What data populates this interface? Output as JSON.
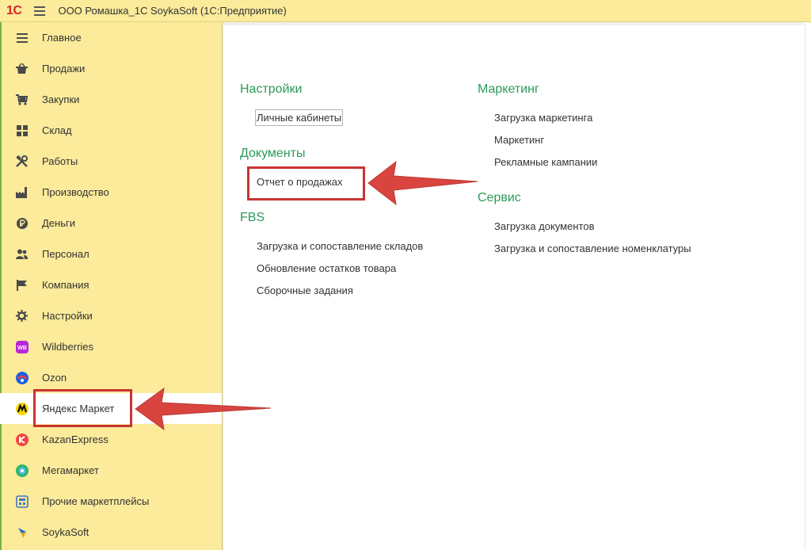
{
  "header": {
    "logo": "1С",
    "title": "ООО Ромашка_1С SoykaSoft  (1С:Предприятие)"
  },
  "sidebar": {
    "items": [
      {
        "label": "Главное",
        "icon": "menu-lines-icon"
      },
      {
        "label": "Продажи",
        "icon": "basket-icon"
      },
      {
        "label": "Закупки",
        "icon": "cart-icon"
      },
      {
        "label": "Склад",
        "icon": "warehouse-grid-icon"
      },
      {
        "label": "Работы",
        "icon": "tools-icon"
      },
      {
        "label": "Производство",
        "icon": "factory-icon"
      },
      {
        "label": "Деньги",
        "icon": "ruble-coin-icon"
      },
      {
        "label": "Персонал",
        "icon": "people-icon"
      },
      {
        "label": "Компания",
        "icon": "flag-icon"
      },
      {
        "label": "Настройки",
        "icon": "gear-icon"
      },
      {
        "label": "Wildberries",
        "icon": "wildberries-icon"
      },
      {
        "label": "Ozon",
        "icon": "ozon-icon"
      },
      {
        "label": "Яндекс Маркет",
        "icon": "yandex-market-icon"
      },
      {
        "label": "KazanExpress",
        "icon": "kazanexpress-icon"
      },
      {
        "label": "Мегамаркет",
        "icon": "megamarket-icon"
      },
      {
        "label": "Прочие маркетплейсы",
        "icon": "marketplaces-icon"
      },
      {
        "label": "SoykaSoft",
        "icon": "soykasoft-icon"
      }
    ],
    "active_index": 12
  },
  "content": {
    "left_column": {
      "settings": {
        "title": "Настройки",
        "links": [
          "Личные кабинеты"
        ]
      },
      "documents": {
        "title": "Документы",
        "links": [
          "Отчет о продажах"
        ]
      },
      "fbs": {
        "title": "FBS",
        "links": [
          "Загрузка и сопоставление складов",
          "Обновление остатков товара",
          "Сборочные задания"
        ]
      }
    },
    "right_column": {
      "marketing": {
        "title": "Маркетинг",
        "links": [
          "Загрузка маркетинга",
          "Маркетинг",
          "Рекламные кампании"
        ]
      },
      "service": {
        "title": "Сервис",
        "links": [
          "Загрузка документов",
          "Загрузка и сопоставление номенклатуры"
        ]
      }
    }
  },
  "colors": {
    "panel": "#fbeb9b",
    "section_heading": "#2c9a5a",
    "annotation": "#c93434",
    "logo": "#d8272b"
  }
}
